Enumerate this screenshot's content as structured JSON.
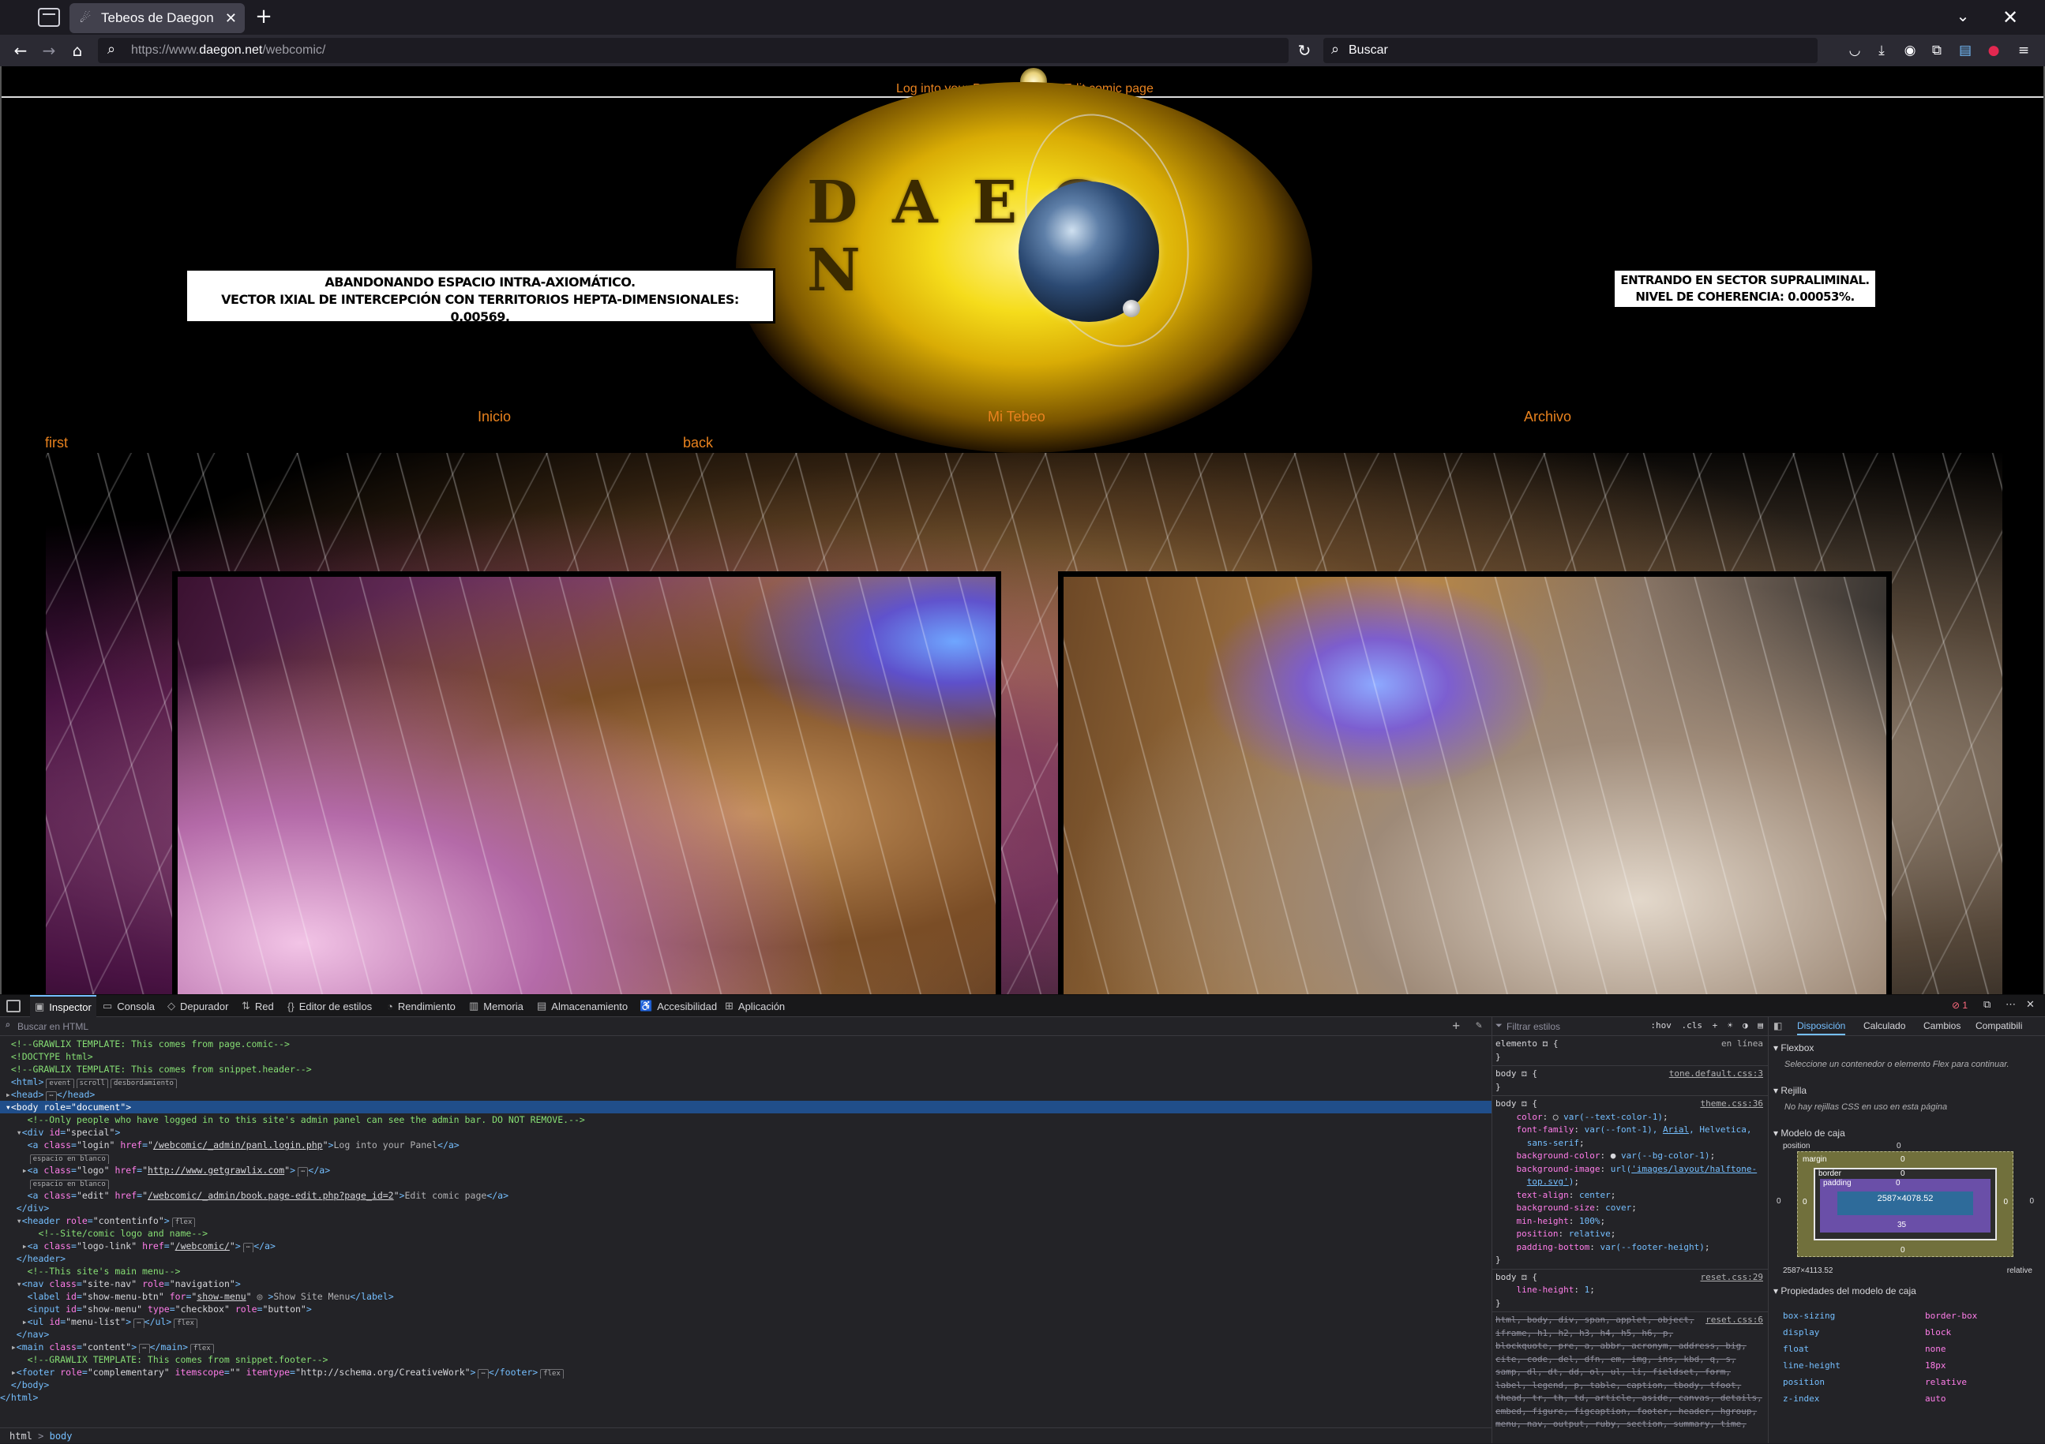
{
  "browser": {
    "tab_title": "Tebeos de Daegon - Regr",
    "url_prefix": "https://www.",
    "url_host": "daegon.net",
    "url_path": "/webcomic/",
    "search_placeholder": "Buscar"
  },
  "page": {
    "admin_login": "Log into your Panel",
    "admin_edit": "Edit comic page",
    "logo_text": "DAEG  N",
    "nav": [
      "Inicio",
      "Mi Tebeo",
      "Archivo"
    ],
    "pager_first": "first",
    "pager_back": "back",
    "caption_1_line1": "ABANDONANDO ESPACIO INTRA-AXIOMÁTICO.",
    "caption_1_line2": "VECTOR IXIAL DE INTERCEPCIÓN CON TERRITORIOS HEPTA-DIMENSIONALES: 0.00569.",
    "caption_2_line1": "ENTRANDO EN SECTOR SUPRALIMINAL.",
    "caption_2_line2": "NIVEL DE COHERENCIA: 0.00053%."
  },
  "devtools": {
    "tabs": [
      "Inspector",
      "Consola",
      "Depurador",
      "Red",
      "Editor de estilos",
      "Rendimiento",
      "Memoria",
      "Almacenamiento",
      "Accesibilidad",
      "Aplicación"
    ],
    "error_count": "1",
    "markup_search_placeholder": "Buscar en HTML",
    "breadcrumb_1": "html",
    "breadcrumb_2": "body",
    "rules_filter_placeholder": "Filtrar estilos",
    "rules_tools": ":hov .cls",
    "layout_tabs": [
      "Disposición",
      "Calculado",
      "Cambios",
      "Compatibili"
    ],
    "flexbox_title": "Flexbox",
    "flexbox_note": "Seleccione un contenedor o elemento Flex para continuar.",
    "grid_title": "Rejilla",
    "grid_note": "No hay rejillas CSS en uso en esta página",
    "boxmodel_title": "Modelo de caja",
    "boxmodel_position_label": "position",
    "boxmodel_margin_label": "margin",
    "boxmodel_border_label": "border",
    "boxmodel_padding_label": "padding",
    "boxmodel_content": "2587×4078.52",
    "boxmodel_padding_bottom": "35",
    "boxmodel_zero": "0",
    "boxmodel_size": "2587×4113.52",
    "boxmodel_position_value": "relative",
    "props_title": "Propiedades del modelo de caja",
    "props": [
      {
        "k": "box-sizing",
        "v": "border-box"
      },
      {
        "k": "display",
        "v": "block"
      },
      {
        "k": "float",
        "v": "none"
      },
      {
        "k": "line-height",
        "v": "18px"
      },
      {
        "k": "position",
        "v": "relative"
      },
      {
        "k": "z-index",
        "v": "auto"
      }
    ]
  }
}
